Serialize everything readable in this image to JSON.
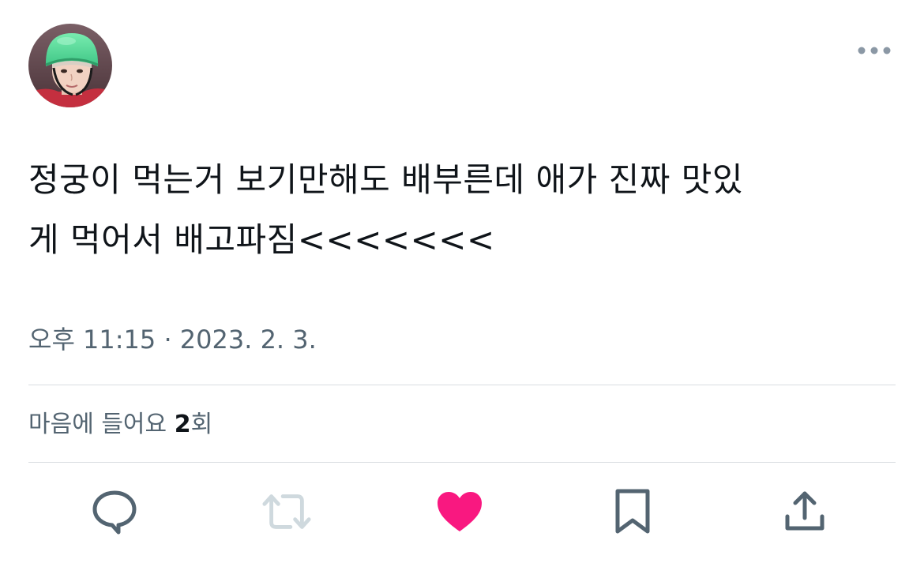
{
  "tweet": {
    "text": "정궁이 먹는거 보기만해도 배부른데 애가 진짜 맛있\n게 먹어서 배고파짐<<<<<<<",
    "timestamp": "오후 11:15 · 2023. 2. 3.",
    "likes_prefix": "마음에 들어요 ",
    "likes_count": "2",
    "likes_suffix": "회"
  },
  "icons": {
    "more": "more-horizontal-icon",
    "reply": "reply-icon",
    "retweet": "retweet-icon",
    "like": "heart-icon",
    "bookmark": "bookmark-icon",
    "share": "share-icon"
  },
  "colors": {
    "text_primary": "#0f1419",
    "text_secondary": "#536471",
    "icon_gray": "#536471",
    "retweet_disabled": "#cfd9de",
    "like_active": "#f91880",
    "divider": "#d9dde1"
  }
}
